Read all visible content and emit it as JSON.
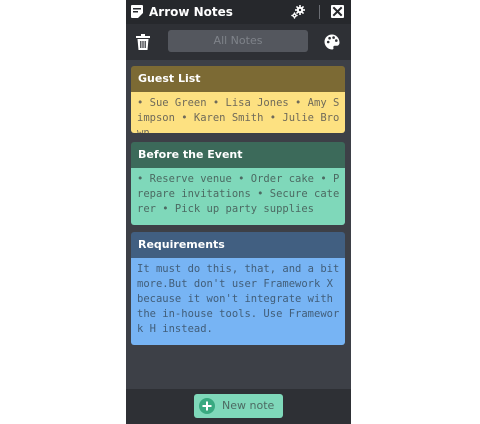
{
  "app": {
    "title": "Arrow Notes",
    "icons": {
      "app": "note-icon",
      "settings": "gear-icon",
      "close": "close-icon",
      "delete": "trash-icon",
      "color": "palette-icon",
      "add": "plus-circle-icon"
    }
  },
  "toolbar": {
    "filter_value": "All Notes"
  },
  "notes": [
    {
      "title": "Guest List",
      "body": "• Sue Green • Lisa Jones • Amy Simpson • Karen Smith • Julie Brown",
      "header_color": "#7c6a34",
      "body_color": "#fde181"
    },
    {
      "title": "Before the Event",
      "body": "• Reserve venue • Order cake • Prepare invitations • Secure caterer • Pick up party supplies",
      "header_color": "#3c6a5a",
      "body_color": "#7fd8ba"
    },
    {
      "title": "Requirements",
      "body": "It must do this, that, and a bit more.But don't user Framework X because it won't integrate with the in-house tools. Use Framework H instead.",
      "header_color": "#415f81",
      "body_color": "#77b4f4"
    }
  ],
  "footer": {
    "new_note_label": "New note"
  },
  "colors": {
    "window_bg": "#3d4047",
    "titlebar_bg": "#26282c",
    "toolbar_bg": "#2e3035",
    "accent": "#7fd8ba"
  }
}
